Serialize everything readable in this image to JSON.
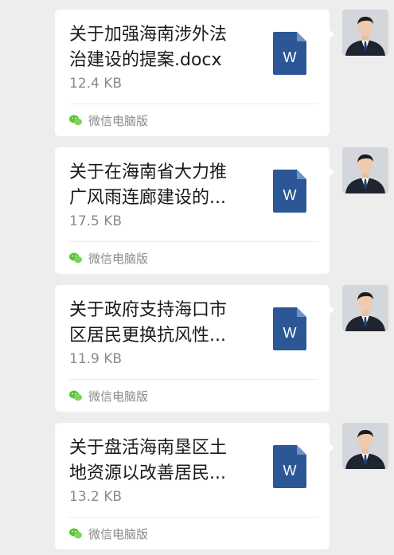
{
  "messages": [
    {
      "title_lines": [
        "关于加强海南涉外法",
        "治建设的提案.docx"
      ],
      "size": "12.4 KB",
      "source": "微信电脑版"
    },
    {
      "title_lines": [
        "关于在海南省大力推",
        "广风雨连廊建设的..."
      ],
      "size": "17.5 KB",
      "source": "微信电脑版"
    },
    {
      "title_lines": [
        "关于政府支持海口市",
        "区居民更换抗风性..."
      ],
      "size": "11.9 KB",
      "source": "微信电脑版"
    },
    {
      "title_lines": [
        "关于盘活海南垦区土",
        "地资源以改善居民..."
      ],
      "size": "13.2 KB",
      "source": "微信电脑版"
    }
  ],
  "file_icon": {
    "name": "word-document-icon",
    "letter": "W",
    "color": "#2b5797"
  },
  "source_icon": {
    "name": "wechat-icon",
    "color": "#5bc236"
  },
  "colors": {
    "background": "#ededed",
    "bubble": "#ffffff"
  }
}
